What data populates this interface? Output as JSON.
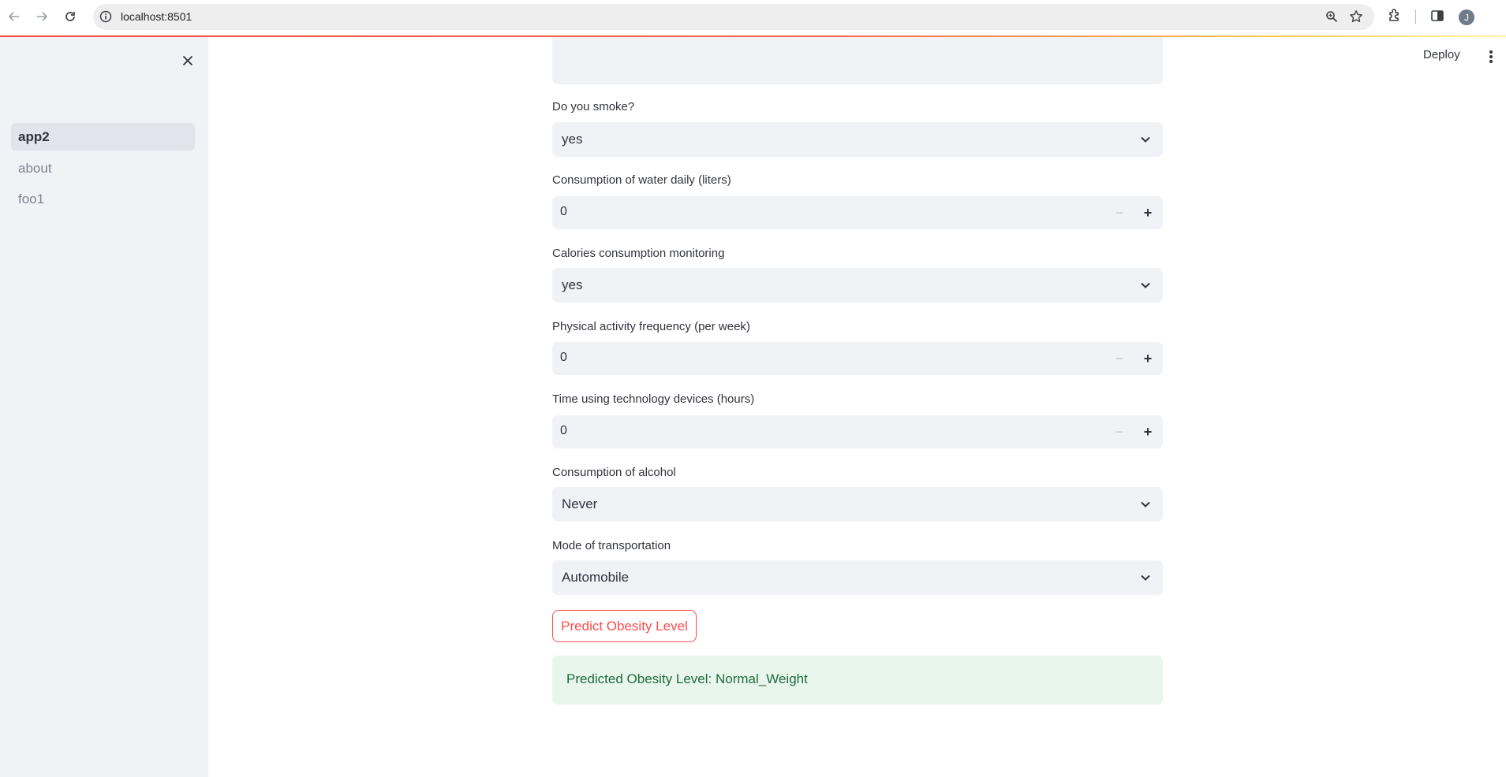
{
  "browser": {
    "url": "localhost:8501",
    "avatar_letter": "J"
  },
  "sidebar": {
    "items": [
      {
        "label": "app2",
        "active": true
      },
      {
        "label": "about",
        "active": false
      },
      {
        "label": "foo1",
        "active": false
      }
    ]
  },
  "header": {
    "deploy_label": "Deploy"
  },
  "form": {
    "smoke": {
      "label": "Do you smoke?",
      "value": "yes"
    },
    "water": {
      "label": "Consumption of water daily (liters)",
      "value": "0"
    },
    "calories": {
      "label": "Calories consumption monitoring",
      "value": "yes"
    },
    "activity": {
      "label": "Physical activity frequency (per week)",
      "value": "0"
    },
    "tech": {
      "label": "Time using technology devices (hours)",
      "value": "0"
    },
    "alcohol": {
      "label": "Consumption of alcohol",
      "value": "Never"
    },
    "transport": {
      "label": "Mode of transportation",
      "value": "Automobile"
    }
  },
  "predict_button_label": "Predict Obesity Level",
  "result_text": "Predicted Obesity Level: Normal_Weight",
  "colors": {
    "accent": "#ff4b4b",
    "sidebar_bg": "#f0f2f6",
    "success_bg": "#e8f6ec",
    "success_text": "#1f6b3a"
  },
  "icons": [
    "back-arrow-icon",
    "forward-arrow-icon",
    "reload-icon",
    "info-icon",
    "zoom-icon",
    "star-icon",
    "extensions-icon",
    "side-panel-icon",
    "profile-avatar-icon",
    "close-icon",
    "chevron-down-icon",
    "minus-icon",
    "plus-icon",
    "more-vert-icon"
  ]
}
